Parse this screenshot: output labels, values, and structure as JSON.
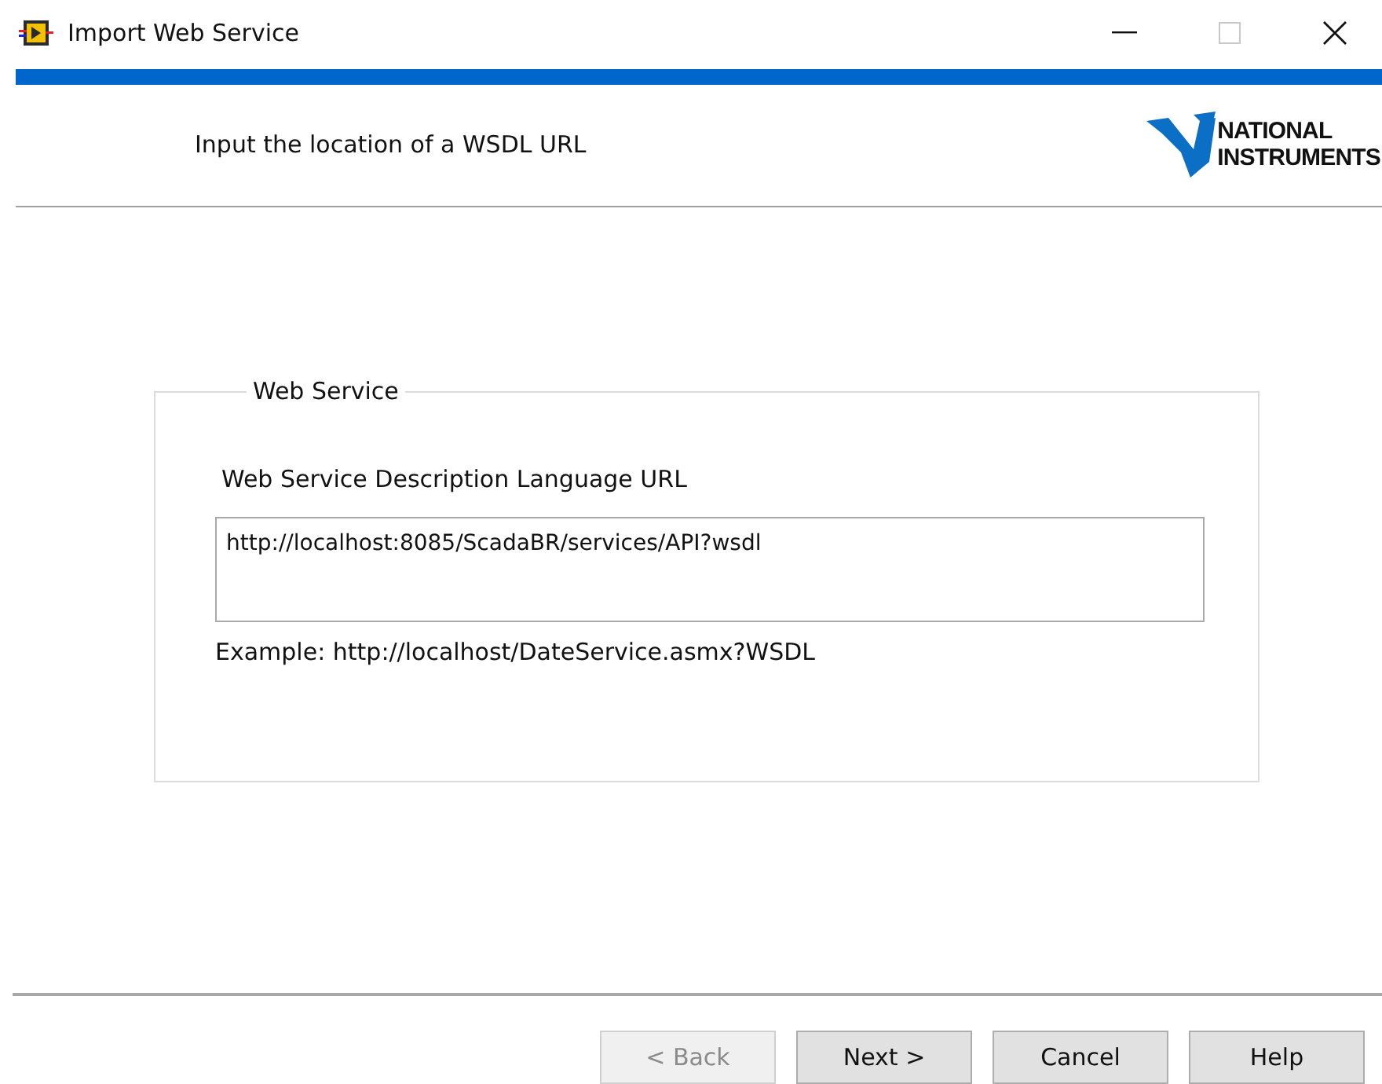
{
  "window": {
    "title": "Import Web Service"
  },
  "header": {
    "instruction": "Input the location of a WSDL URL",
    "logo": [
      "NATIONAL",
      "INSTRUMENTS"
    ]
  },
  "group": {
    "title": "Web Service",
    "field_label": "Web Service Description Language URL",
    "url": "http://localhost:8085/ScadaBR/services/API?wsdl",
    "example": "Example: http://localhost/DateService.asmx?WSDL"
  },
  "buttons": [
    {
      "label": "< Back",
      "disabled": true
    },
    {
      "label": "Next >",
      "disabled": false
    },
    {
      "label": "Cancel",
      "disabled": false
    },
    {
      "label": "Help",
      "disabled": false
    }
  ]
}
